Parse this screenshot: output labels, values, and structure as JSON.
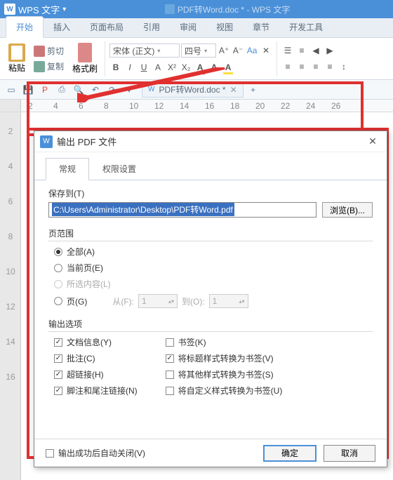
{
  "titlebar": {
    "app": "WPS 文字",
    "doc": "PDF转Word.doc * - WPS 文字"
  },
  "menu": {
    "tabs": [
      "开始",
      "插入",
      "页面布局",
      "引用",
      "审阅",
      "视图",
      "章节",
      "开发工具"
    ],
    "active": 0
  },
  "ribbon": {
    "paste": "粘贴",
    "cut": "剪切",
    "copy": "复制",
    "format": "格式刷",
    "font_name": "宋体 (正文)",
    "font_size": "四号"
  },
  "doc_tab": {
    "name": "PDF转Word.doc *"
  },
  "ruler": {
    "nums": [
      "2",
      "4",
      "6",
      "8",
      "10",
      "12",
      "14",
      "16",
      "18",
      "20",
      "22",
      "24",
      "26"
    ]
  },
  "vruler": {
    "nums": [
      "2",
      "4",
      "6",
      "8",
      "10",
      "12",
      "14",
      "16"
    ]
  },
  "dialog": {
    "title": "输出 PDF 文件",
    "tabs": {
      "general": "常规",
      "perm": "权限设置"
    },
    "save_to": "保存到(T)",
    "path": "C:\\Users\\Administrator\\Desktop\\PDF转Word.pdf",
    "browse": "浏览(B)...",
    "range_lbl": "页范围",
    "r_all": "全部(A)",
    "r_cur": "当前页(E)",
    "r_sel": "所选内容(L)",
    "r_page": "页(G)",
    "from": "从(F):",
    "to": "到(O):",
    "from_v": "1",
    "to_v": "1",
    "out_lbl": "输出选项",
    "o_docinfo": "文档信息(Y)",
    "o_anno": "批注(C)",
    "o_hyper": "超链接(H)",
    "o_foot": "脚注和尾注链接(N)",
    "o_bm": "书签(K)",
    "o_title": "将标题样式转换为书签(V)",
    "o_other": "将其他样式转换为书签(S)",
    "o_cust": "将自定义样式转换为书签(U)",
    "close_after": "输出成功后自动关闭(V)",
    "ok": "确定",
    "cancel": "取消"
  }
}
